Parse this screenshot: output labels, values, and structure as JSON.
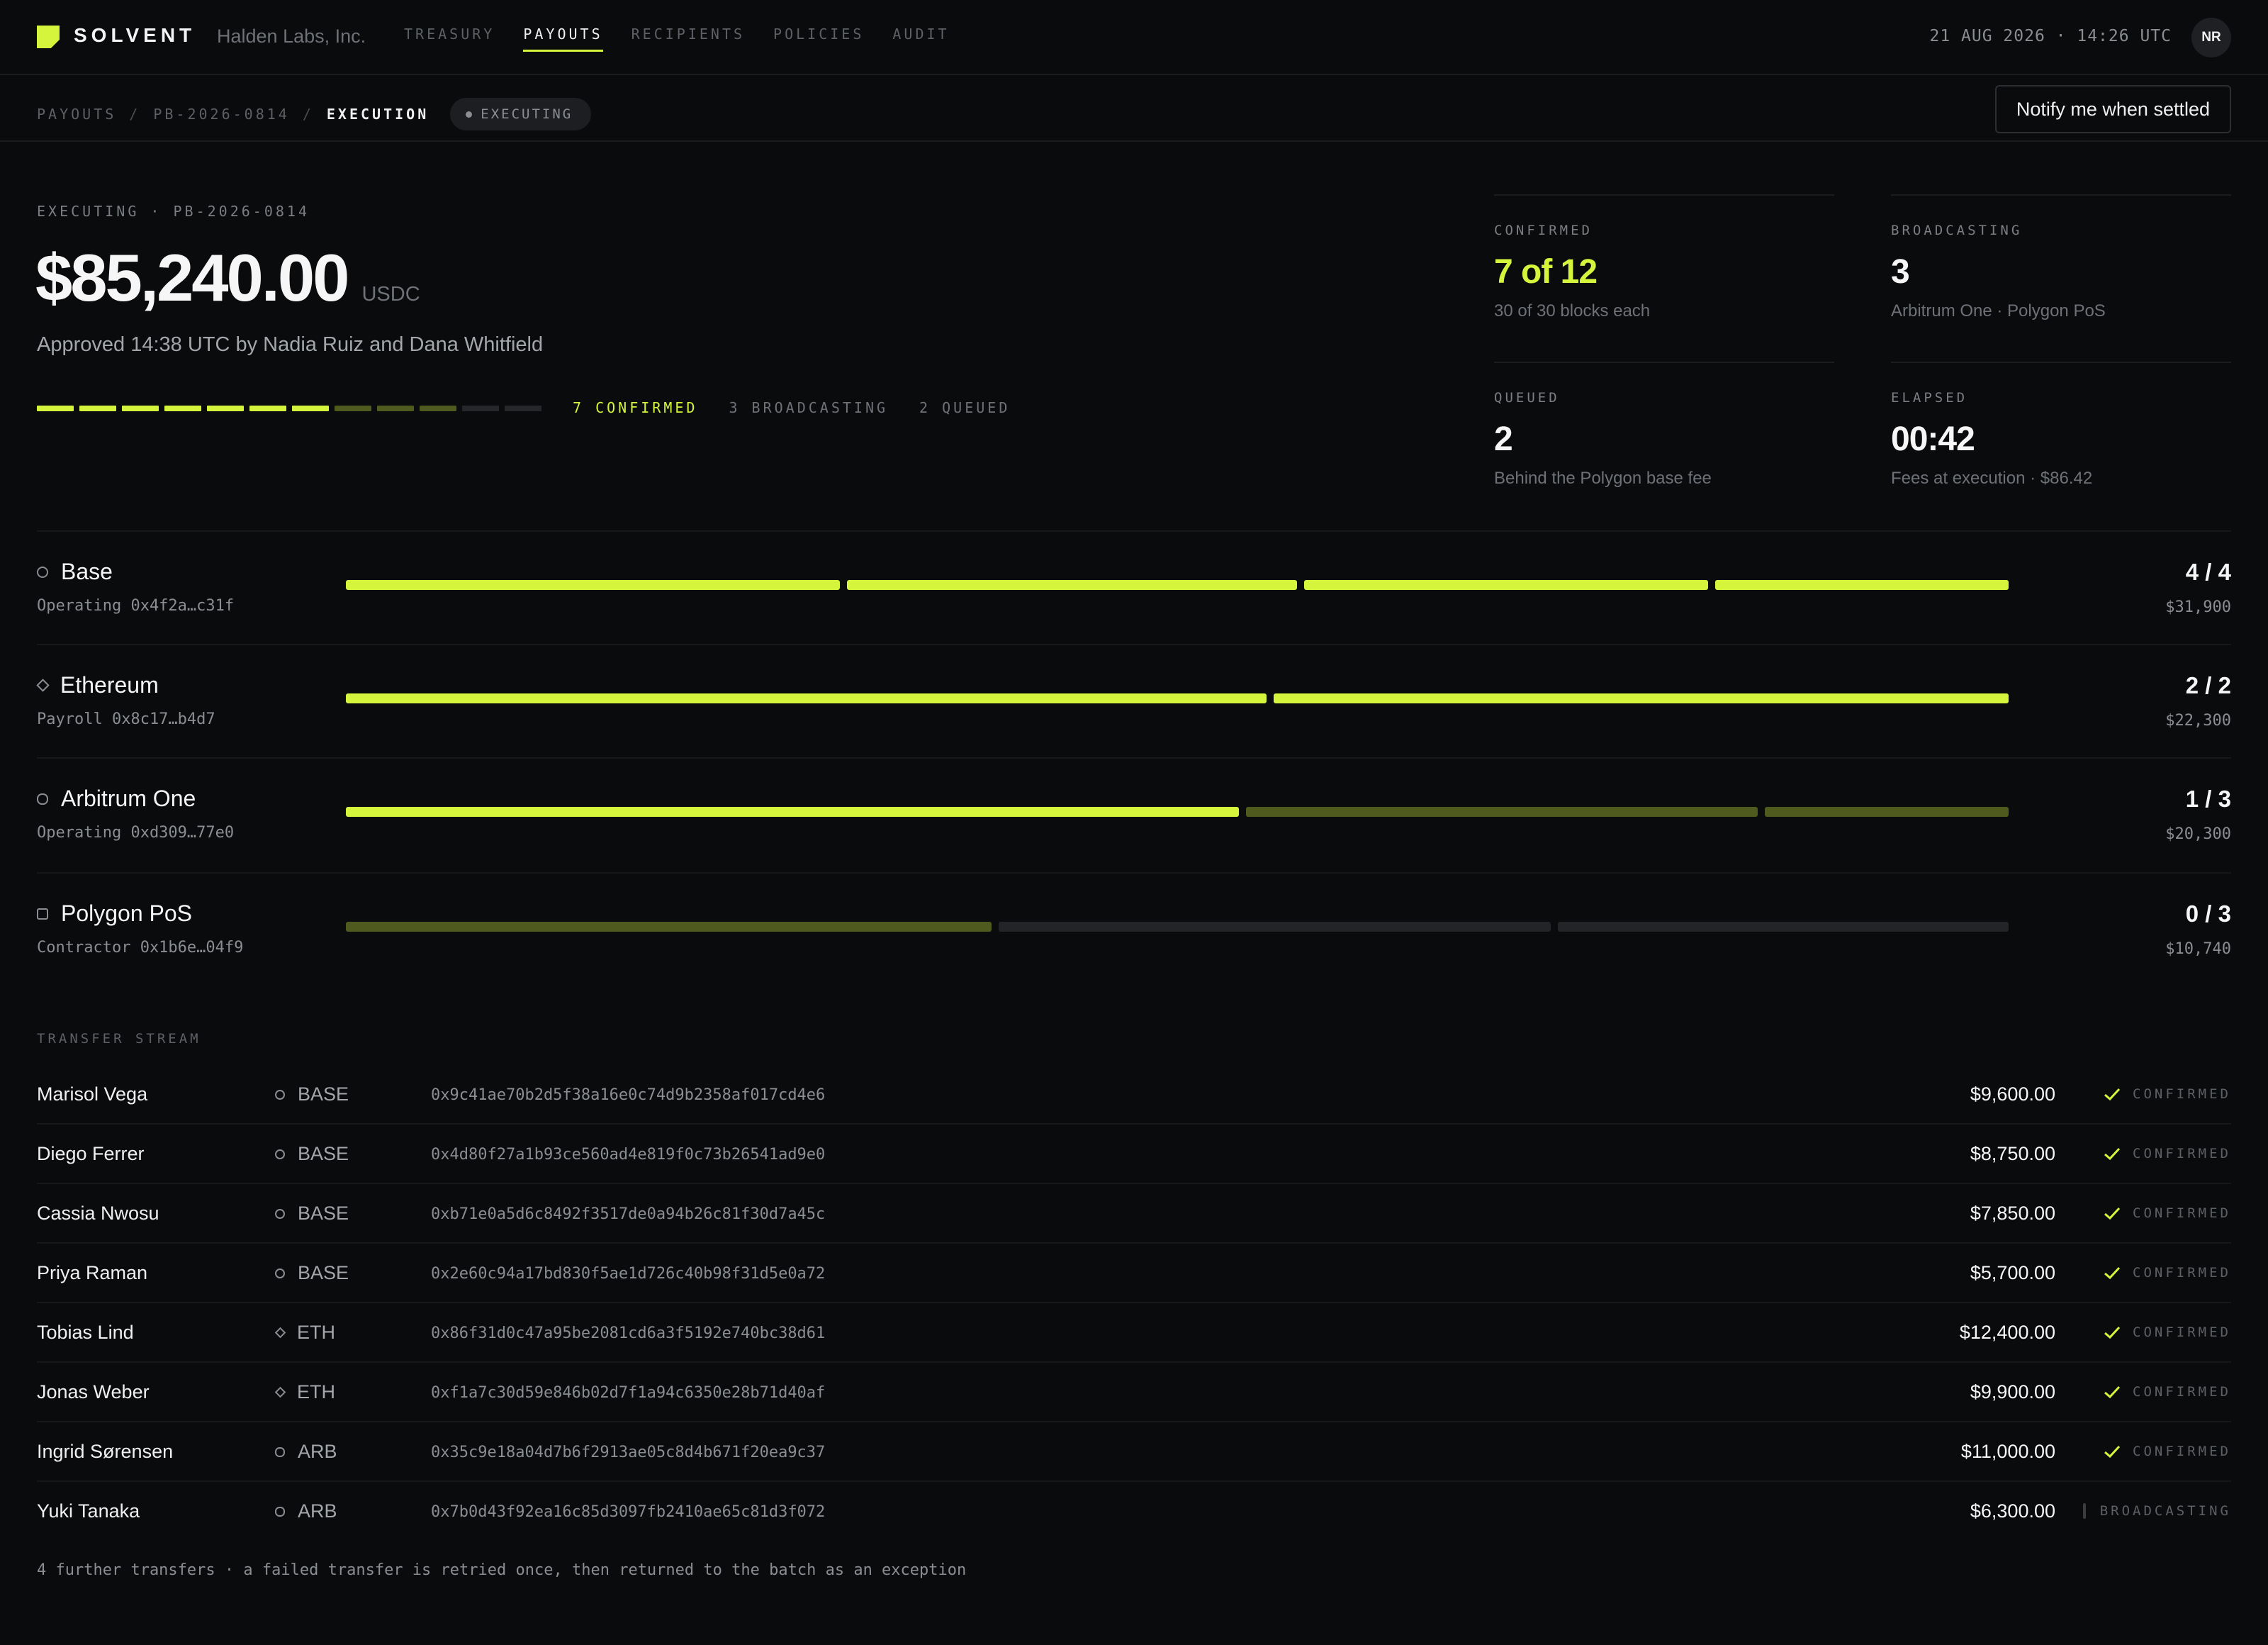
{
  "header": {
    "brand": "SOLVENT",
    "org": "Halden Labs, Inc.",
    "nav": [
      "TREASURY",
      "PAYOUTS",
      "RECIPIENTS",
      "POLICIES",
      "AUDIT"
    ],
    "active_nav": "PAYOUTS",
    "clock": "21 AUG 2026 · 14:26 UTC",
    "avatar": "NR"
  },
  "breadcrumb": {
    "items": [
      "PAYOUTS",
      "PB-2026-0814",
      "EXECUTION"
    ],
    "status": "EXECUTING"
  },
  "notify_button": "Notify me when settled",
  "hero": {
    "eyebrow": "EXECUTING · PB-2026-0814",
    "amount": "$85,240.00",
    "unit": "USDC",
    "approved": "Approved 14:38 UTC by Nadia Ruiz and Dana Whitfield",
    "progress": {
      "confirmed": 7,
      "broadcasting": 3,
      "queued": 2,
      "total": 12
    },
    "legend": {
      "confirmed": "7 CONFIRMED",
      "broadcasting": "3 BROADCASTING",
      "queued": "2 QUEUED"
    }
  },
  "stats": {
    "confirmed": {
      "label": "CONFIRMED",
      "value": "7 of 12",
      "sub": "30 of 30 blocks each"
    },
    "broadcasting": {
      "label": "BROADCASTING",
      "value": "3",
      "sub": "Arbitrum One · Polygon PoS"
    },
    "queued": {
      "label": "QUEUED",
      "value": "2",
      "sub": "Behind the Polygon base fee"
    },
    "elapsed": {
      "label": "ELAPSED",
      "value": "00:42",
      "sub": "Fees at execution · $86.42"
    }
  },
  "chains": [
    {
      "name": "Base",
      "icon": "circle-icon",
      "account": "Operating 0x4f2a…c31f",
      "count": "4 / 4",
      "amount": "$31,900",
      "transfers": [
        {
          "weight": 9600,
          "state": "confirmed"
        },
        {
          "weight": 8750,
          "state": "confirmed"
        },
        {
          "weight": 7850,
          "state": "confirmed"
        },
        {
          "weight": 5700,
          "state": "confirmed"
        }
      ]
    },
    {
      "name": "Ethereum",
      "icon": "diamond-icon",
      "account": "Payroll 0x8c17…b4d7",
      "count": "2 / 2",
      "amount": "$22,300",
      "transfers": [
        {
          "weight": 12400,
          "state": "confirmed"
        },
        {
          "weight": 9900,
          "state": "confirmed"
        }
      ]
    },
    {
      "name": "Arbitrum One",
      "icon": "hexagon-icon",
      "account": "Operating 0xd309…77e0",
      "count": "1 / 3",
      "amount": "$20,300",
      "transfers": [
        {
          "weight": 11000,
          "state": "confirmed"
        },
        {
          "weight": 6300,
          "state": "broadcasting"
        },
        {
          "weight": 3000,
          "state": "broadcasting"
        }
      ]
    },
    {
      "name": "Polygon PoS",
      "icon": "square-icon",
      "account": "Contractor 0x1b6e…04f9",
      "count": "0 / 3",
      "amount": "$10,740",
      "transfers": [
        {
          "weight": 4150,
          "state": "broadcasting"
        },
        {
          "weight": 3550,
          "state": "queued"
        },
        {
          "weight": 2900,
          "state": "queued"
        }
      ]
    }
  ],
  "stream": {
    "label": "TRANSFER STREAM",
    "rows": [
      {
        "name": "Marisol Vega",
        "chain": "BASE",
        "icon": "circle-icon",
        "hash": "0x9c41ae70b2d5f38a16e0c74d9b2358af017cd4e6",
        "amount": "$9,600.00",
        "status": "CONFIRMED"
      },
      {
        "name": "Diego Ferrer",
        "chain": "BASE",
        "icon": "circle-icon",
        "hash": "0x4d80f27a1b93ce560ad4e819f0c73b26541ad9e0",
        "amount": "$8,750.00",
        "status": "CONFIRMED"
      },
      {
        "name": "Cassia Nwosu",
        "chain": "BASE",
        "icon": "circle-icon",
        "hash": "0xb71e0a5d6c8492f3517de0a94b26c81f30d7a45c",
        "amount": "$7,850.00",
        "status": "CONFIRMED"
      },
      {
        "name": "Priya Raman",
        "chain": "BASE",
        "icon": "circle-icon",
        "hash": "0x2e60c94a17bd830f5ae1d726c40b98f31d5e0a72",
        "amount": "$5,700.00",
        "status": "CONFIRMED"
      },
      {
        "name": "Tobias Lind",
        "chain": "ETH",
        "icon": "diamond-icon",
        "hash": "0x86f31d0c47a95be2081cd6a3f5192e740bc38d61",
        "amount": "$12,400.00",
        "status": "CONFIRMED"
      },
      {
        "name": "Jonas Weber",
        "chain": "ETH",
        "icon": "diamond-icon",
        "hash": "0xf1a7c30d59e846b02d7f1a94c6350e28b71d40af",
        "amount": "$9,900.00",
        "status": "CONFIRMED"
      },
      {
        "name": "Ingrid Sørensen",
        "chain": "ARB",
        "icon": "hexagon-icon",
        "hash": "0x35c9e18a04d7b6f2913ae05c8d4b671f20ea9c37",
        "amount": "$11,000.00",
        "status": "CONFIRMED"
      },
      {
        "name": "Yuki Tanaka",
        "chain": "ARB",
        "icon": "hexagon-icon",
        "hash": "0x7b0d43f92ea16c85d3097fb2410ae65c81d3f072",
        "amount": "$6,300.00",
        "status": "BROADCASTING"
      }
    ],
    "footnote": "4 further transfers · a failed transfer is retried once, then returned to the batch as an exception"
  },
  "colors": {
    "accent": "#d4f53c",
    "broadcasting": "#4f5a1f",
    "queued": "#25272b",
    "background": "#0a0b0d"
  }
}
